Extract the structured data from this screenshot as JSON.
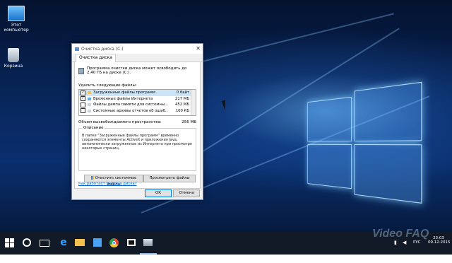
{
  "desktop": {
    "icons": [
      {
        "label": "Этот компьютер"
      },
      {
        "label": "Корзина"
      }
    ]
  },
  "dialog": {
    "title": "Очистка диска (C:)",
    "tab": "Очистка диска",
    "summary": "Программа очистки диска может освободить до 2,40 ГБ на диске (C:).",
    "delete_label": "Удалить следующие файлы:",
    "files": [
      {
        "label": "Загруженные файлы программ",
        "size": "0 байт",
        "checked": true,
        "selected": true
      },
      {
        "label": "Временные файлы Интернета",
        "size": "217 МБ",
        "checked": true,
        "selected": false
      },
      {
        "label": "Файлы дампа памяти для системны...",
        "size": "452 МБ",
        "checked": false,
        "selected": false
      },
      {
        "label": "Системные архивы отчетов об ошиб...",
        "size": "100 КБ",
        "checked": false,
        "selected": false
      }
    ],
    "freed_label": "Объем высвобождаемого пространства:",
    "freed_value": "256 МБ",
    "description_legend": "Описание",
    "description_text": "В папке \"Загруженные файлы программ\" временно сохраняются элементы ActiveX и приложения Java, автоматически загруженные из Интернета при просмотре некоторых страниц.",
    "clean_system_button": "Очистить системные файлы",
    "view_files_button": "Просмотреть файлы",
    "how_link": "Как работает очистка диска?",
    "ok_button": "ОК",
    "cancel_button": "Отмена"
  },
  "taskbar": {
    "language": "РУС",
    "time": "23:03",
    "date": "09.12.2015"
  },
  "watermark": "Video FAQ"
}
